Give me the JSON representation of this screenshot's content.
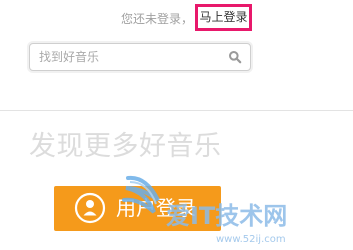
{
  "header": {
    "login_prompt": "您还未登录，",
    "login_link": "马上登录"
  },
  "search": {
    "placeholder": "找到好音乐",
    "value": ""
  },
  "main": {
    "slogan": "发现更多好音乐",
    "user_login_button": "用户登录"
  },
  "watermark": {
    "brand": "爱IT技术网",
    "url": "www.52ij.com"
  },
  "colors": {
    "accent_orange": "#f59a1b",
    "highlight_pink": "#e8186b",
    "watermark_blue": "#6aaee8"
  },
  "icons": {
    "search": "search-icon",
    "user": "user-icon"
  }
}
